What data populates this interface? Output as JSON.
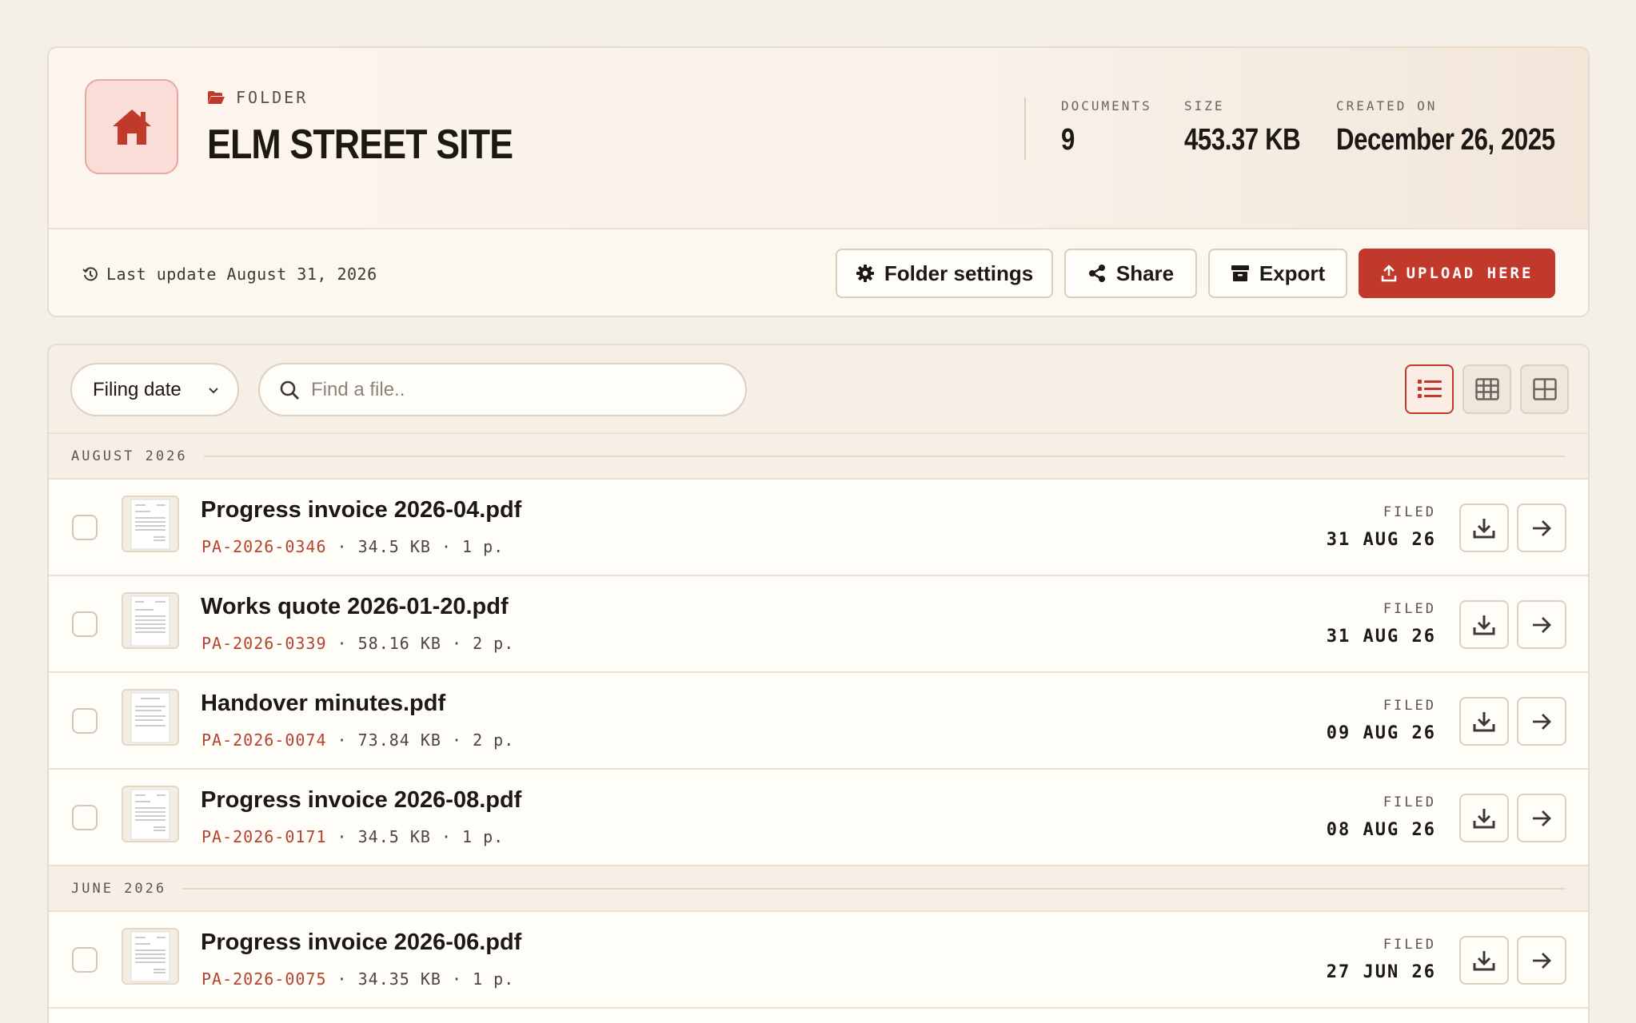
{
  "folder": {
    "kicker": "FOLDER",
    "title": "ELM STREET SITE",
    "icon": "home-icon"
  },
  "stats": {
    "documents_label": "DOCUMENTS",
    "documents_value": "9",
    "size_label": "SIZE",
    "size_value": "453.37 KB",
    "created_label": "CREATED ON",
    "created_value": "December 26, 2025"
  },
  "last_update": "Last update August 31, 2026",
  "actions": {
    "settings": "Folder settings",
    "share": "Share",
    "export": "Export",
    "upload": "UPLOAD HERE"
  },
  "toolbar": {
    "sort_value": "Filing date",
    "search_placeholder": "Find a file.."
  },
  "colors": {
    "accent": "#c0392b",
    "background": "#f4efe7",
    "reference": "#b5432f"
  },
  "groups": [
    {
      "label": "AUGUST 2026",
      "files": [
        {
          "name": "Progress invoice 2026-04.pdf",
          "ref": "PA-2026-0346",
          "details": " · 34.5 KB · 1 p.",
          "filed_label": "FILED",
          "filed_date": "31 AUG 26"
        },
        {
          "name": "Works quote 2026-01-20.pdf",
          "ref": "PA-2026-0339",
          "details": " · 58.16 KB · 2 p.",
          "filed_label": "FILED",
          "filed_date": "31 AUG 26"
        },
        {
          "name": "Handover minutes.pdf",
          "ref": "PA-2026-0074",
          "details": " · 73.84 KB · 2 p.",
          "filed_label": "FILED",
          "filed_date": "09 AUG 26"
        },
        {
          "name": "Progress invoice 2026-08.pdf",
          "ref": "PA-2026-0171",
          "details": " · 34.5 KB · 1 p.",
          "filed_label": "FILED",
          "filed_date": "08 AUG 26"
        }
      ]
    },
    {
      "label": "JUNE 2026",
      "files": [
        {
          "name": "Progress invoice 2026-06.pdf",
          "ref": "PA-2026-0075",
          "details": " · 34.35 KB · 1 p.",
          "filed_label": "FILED",
          "filed_date": "27 JUN 26"
        }
      ]
    }
  ]
}
